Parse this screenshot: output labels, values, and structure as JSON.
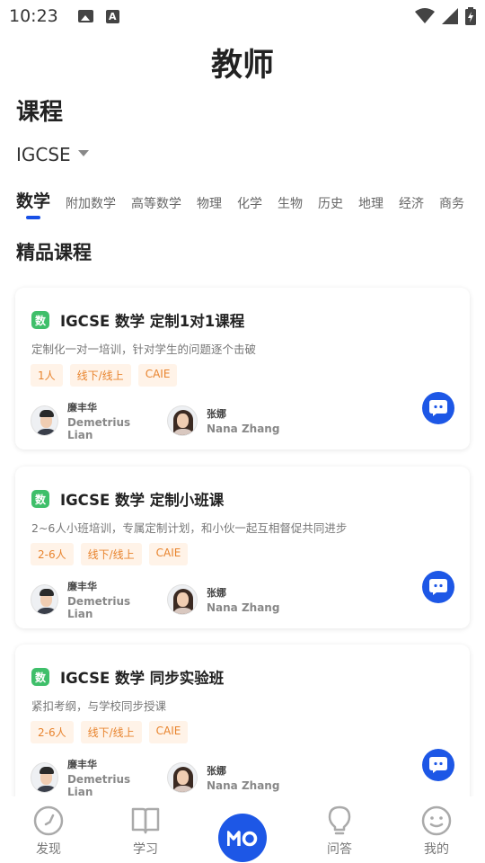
{
  "status_bar": {
    "time": "10:23",
    "a_icon": "A"
  },
  "header": {
    "title": "教师"
  },
  "section": {
    "title": "课程"
  },
  "exam_selector": {
    "value": "IGCSE"
  },
  "subject_tabs": [
    "数学",
    "附加数学",
    "高等数学",
    "物理",
    "化学",
    "生物",
    "历史",
    "地理",
    "经济",
    "商务"
  ],
  "featured": {
    "title": "精品课程"
  },
  "courses": [
    {
      "badge": "数",
      "title": "IGCSE 数学 定制1对1课程",
      "desc": "定制化一对一培训，针对学生的问题逐个击破",
      "tags": [
        "1人",
        "线下/线上",
        "CAIE"
      ],
      "teachers": [
        {
          "cn": "廉丰华",
          "en": "Demetrius Lian"
        },
        {
          "cn": "张娜",
          "en": "Nana Zhang"
        }
      ]
    },
    {
      "badge": "数",
      "title": "IGCSE 数学 定制小班课",
      "desc": "2~6人小班培训，专属定制计划，和小伙一起互相督促共同进步",
      "tags": [
        "2-6人",
        "线下/线上",
        "CAIE"
      ],
      "teachers": [
        {
          "cn": "廉丰华",
          "en": "Demetrius Lian"
        },
        {
          "cn": "张娜",
          "en": "Nana Zhang"
        }
      ]
    },
    {
      "badge": "数",
      "title": "IGCSE 数学 同步实验班",
      "desc": "紧扣考纲，与学校同步授课",
      "tags": [
        "2-6人",
        "线下/线上",
        "CAIE"
      ],
      "teachers": [
        {
          "cn": "廉丰华",
          "en": "Demetrius Lian"
        },
        {
          "cn": "张娜",
          "en": "Nana Zhang"
        }
      ]
    }
  ],
  "bottom_nav": {
    "discover": "发现",
    "study": "学习",
    "qa": "问答",
    "mine": "我的"
  },
  "colors": {
    "accent": "#1d57e6",
    "tag_text": "#e8842e",
    "tag_bg": "#fff3e8",
    "badge": "#3fbf6a"
  }
}
